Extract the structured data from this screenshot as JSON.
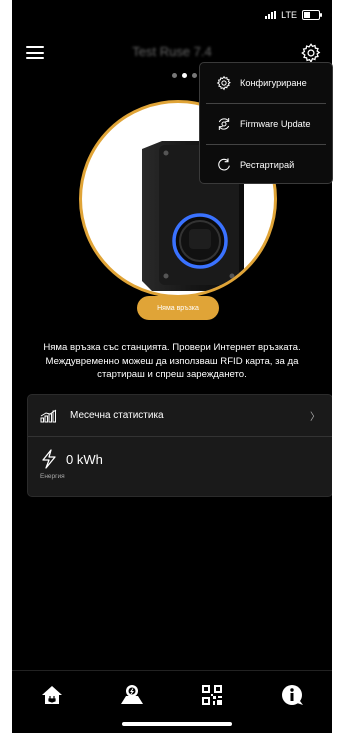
{
  "status_bar": {
    "network": "LTE"
  },
  "header": {
    "title": "Test Ruse 7.4"
  },
  "carousel": {
    "pages": 3,
    "active_index": 1
  },
  "charger": {
    "status_label": "Няма връзка",
    "accent_color": "#e0a437"
  },
  "message": "Няма връзка със станцията. Провери Интернет връзката. Междувременно можеш да използваш RFID карта, за да стартираш и спреш зареждането.",
  "stats": {
    "monthly_label": "Месечна статистика",
    "energy_value": "0 kWh",
    "energy_label": "Енергия"
  },
  "menu": {
    "items": [
      {
        "label": "Конфигуриране",
        "icon": "gear-icon"
      },
      {
        "label": "Firmware Update",
        "icon": "refresh-icon"
      },
      {
        "label": "Рестартирай",
        "icon": "restart-icon"
      }
    ]
  },
  "nav": [
    "home-icon",
    "map-icon",
    "qr-code-icon",
    "info-icon"
  ]
}
